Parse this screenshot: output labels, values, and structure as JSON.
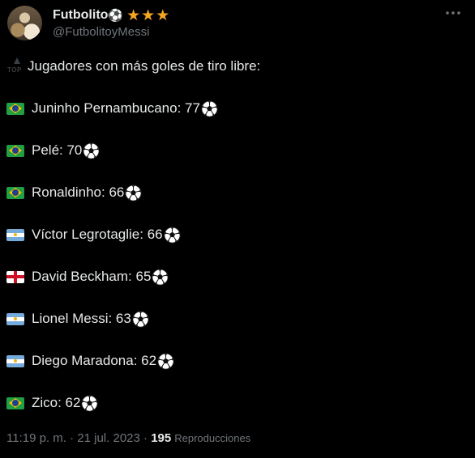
{
  "author": {
    "display_name": "Futbolito",
    "name_emoji": "⚽",
    "badge_stars": [
      "★",
      "★",
      "★"
    ],
    "handle": "@FutbolitoyMessi",
    "avatar_icon": "avatar-photo"
  },
  "more_icon": "more-options-icon",
  "intro": {
    "icon_label": "TOP",
    "text": "Jugadores con más goles de tiro libre:"
  },
  "players": [
    {
      "flag": "brazil",
      "text": "Juninho Pernambucano: 77"
    },
    {
      "flag": "brazil",
      "text": "Pelé: 70"
    },
    {
      "flag": "brazil",
      "text": "Ronaldinho: 66"
    },
    {
      "flag": "argentina",
      "text": "Víctor Legrotaglie: 66"
    },
    {
      "flag": "england",
      "text": "David Beckham: 65"
    },
    {
      "flag": "argentina",
      "text": "Lionel Messi: 63"
    },
    {
      "flag": "argentina",
      "text": "Diego Maradona: 62"
    },
    {
      "flag": "brazil",
      "text": "Zico: 62"
    }
  ],
  "footer": {
    "time": "11:19 p. m.",
    "separator": " · ",
    "date": "21 jul. 2023",
    "separator2": " · ",
    "views_count": "195",
    "views_label": "Reproducciones"
  },
  "colors": {
    "background": "#000000",
    "text": "#e7e9ea",
    "secondary": "#71767b",
    "star": "#f5a623"
  }
}
